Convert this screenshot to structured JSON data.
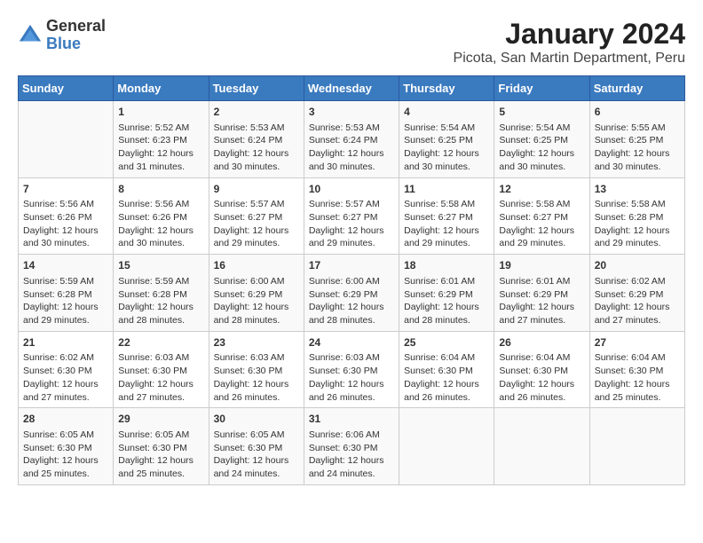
{
  "logo": {
    "general": "General",
    "blue": "Blue"
  },
  "title": "January 2024",
  "subtitle": "Picota, San Martin Department, Peru",
  "days_of_week": [
    "Sunday",
    "Monday",
    "Tuesday",
    "Wednesday",
    "Thursday",
    "Friday",
    "Saturday"
  ],
  "weeks": [
    [
      {
        "day": "",
        "info": ""
      },
      {
        "day": "1",
        "info": "Sunrise: 5:52 AM\nSunset: 6:23 PM\nDaylight: 12 hours\nand 31 minutes."
      },
      {
        "day": "2",
        "info": "Sunrise: 5:53 AM\nSunset: 6:24 PM\nDaylight: 12 hours\nand 30 minutes."
      },
      {
        "day": "3",
        "info": "Sunrise: 5:53 AM\nSunset: 6:24 PM\nDaylight: 12 hours\nand 30 minutes."
      },
      {
        "day": "4",
        "info": "Sunrise: 5:54 AM\nSunset: 6:25 PM\nDaylight: 12 hours\nand 30 minutes."
      },
      {
        "day": "5",
        "info": "Sunrise: 5:54 AM\nSunset: 6:25 PM\nDaylight: 12 hours\nand 30 minutes."
      },
      {
        "day": "6",
        "info": "Sunrise: 5:55 AM\nSunset: 6:25 PM\nDaylight: 12 hours\nand 30 minutes."
      }
    ],
    [
      {
        "day": "7",
        "info": "Sunrise: 5:56 AM\nSunset: 6:26 PM\nDaylight: 12 hours\nand 30 minutes."
      },
      {
        "day": "8",
        "info": "Sunrise: 5:56 AM\nSunset: 6:26 PM\nDaylight: 12 hours\nand 30 minutes."
      },
      {
        "day": "9",
        "info": "Sunrise: 5:57 AM\nSunset: 6:27 PM\nDaylight: 12 hours\nand 29 minutes."
      },
      {
        "day": "10",
        "info": "Sunrise: 5:57 AM\nSunset: 6:27 PM\nDaylight: 12 hours\nand 29 minutes."
      },
      {
        "day": "11",
        "info": "Sunrise: 5:58 AM\nSunset: 6:27 PM\nDaylight: 12 hours\nand 29 minutes."
      },
      {
        "day": "12",
        "info": "Sunrise: 5:58 AM\nSunset: 6:27 PM\nDaylight: 12 hours\nand 29 minutes."
      },
      {
        "day": "13",
        "info": "Sunrise: 5:58 AM\nSunset: 6:28 PM\nDaylight: 12 hours\nand 29 minutes."
      }
    ],
    [
      {
        "day": "14",
        "info": "Sunrise: 5:59 AM\nSunset: 6:28 PM\nDaylight: 12 hours\nand 29 minutes."
      },
      {
        "day": "15",
        "info": "Sunrise: 5:59 AM\nSunset: 6:28 PM\nDaylight: 12 hours\nand 28 minutes."
      },
      {
        "day": "16",
        "info": "Sunrise: 6:00 AM\nSunset: 6:29 PM\nDaylight: 12 hours\nand 28 minutes."
      },
      {
        "day": "17",
        "info": "Sunrise: 6:00 AM\nSunset: 6:29 PM\nDaylight: 12 hours\nand 28 minutes."
      },
      {
        "day": "18",
        "info": "Sunrise: 6:01 AM\nSunset: 6:29 PM\nDaylight: 12 hours\nand 28 minutes."
      },
      {
        "day": "19",
        "info": "Sunrise: 6:01 AM\nSunset: 6:29 PM\nDaylight: 12 hours\nand 27 minutes."
      },
      {
        "day": "20",
        "info": "Sunrise: 6:02 AM\nSunset: 6:29 PM\nDaylight: 12 hours\nand 27 minutes."
      }
    ],
    [
      {
        "day": "21",
        "info": "Sunrise: 6:02 AM\nSunset: 6:30 PM\nDaylight: 12 hours\nand 27 minutes."
      },
      {
        "day": "22",
        "info": "Sunrise: 6:03 AM\nSunset: 6:30 PM\nDaylight: 12 hours\nand 27 minutes."
      },
      {
        "day": "23",
        "info": "Sunrise: 6:03 AM\nSunset: 6:30 PM\nDaylight: 12 hours\nand 26 minutes."
      },
      {
        "day": "24",
        "info": "Sunrise: 6:03 AM\nSunset: 6:30 PM\nDaylight: 12 hours\nand 26 minutes."
      },
      {
        "day": "25",
        "info": "Sunrise: 6:04 AM\nSunset: 6:30 PM\nDaylight: 12 hours\nand 26 minutes."
      },
      {
        "day": "26",
        "info": "Sunrise: 6:04 AM\nSunset: 6:30 PM\nDaylight: 12 hours\nand 26 minutes."
      },
      {
        "day": "27",
        "info": "Sunrise: 6:04 AM\nSunset: 6:30 PM\nDaylight: 12 hours\nand 25 minutes."
      }
    ],
    [
      {
        "day": "28",
        "info": "Sunrise: 6:05 AM\nSunset: 6:30 PM\nDaylight: 12 hours\nand 25 minutes."
      },
      {
        "day": "29",
        "info": "Sunrise: 6:05 AM\nSunset: 6:30 PM\nDaylight: 12 hours\nand 25 minutes."
      },
      {
        "day": "30",
        "info": "Sunrise: 6:05 AM\nSunset: 6:30 PM\nDaylight: 12 hours\nand 24 minutes."
      },
      {
        "day": "31",
        "info": "Sunrise: 6:06 AM\nSunset: 6:30 PM\nDaylight: 12 hours\nand 24 minutes."
      },
      {
        "day": "",
        "info": ""
      },
      {
        "day": "",
        "info": ""
      },
      {
        "day": "",
        "info": ""
      }
    ]
  ]
}
